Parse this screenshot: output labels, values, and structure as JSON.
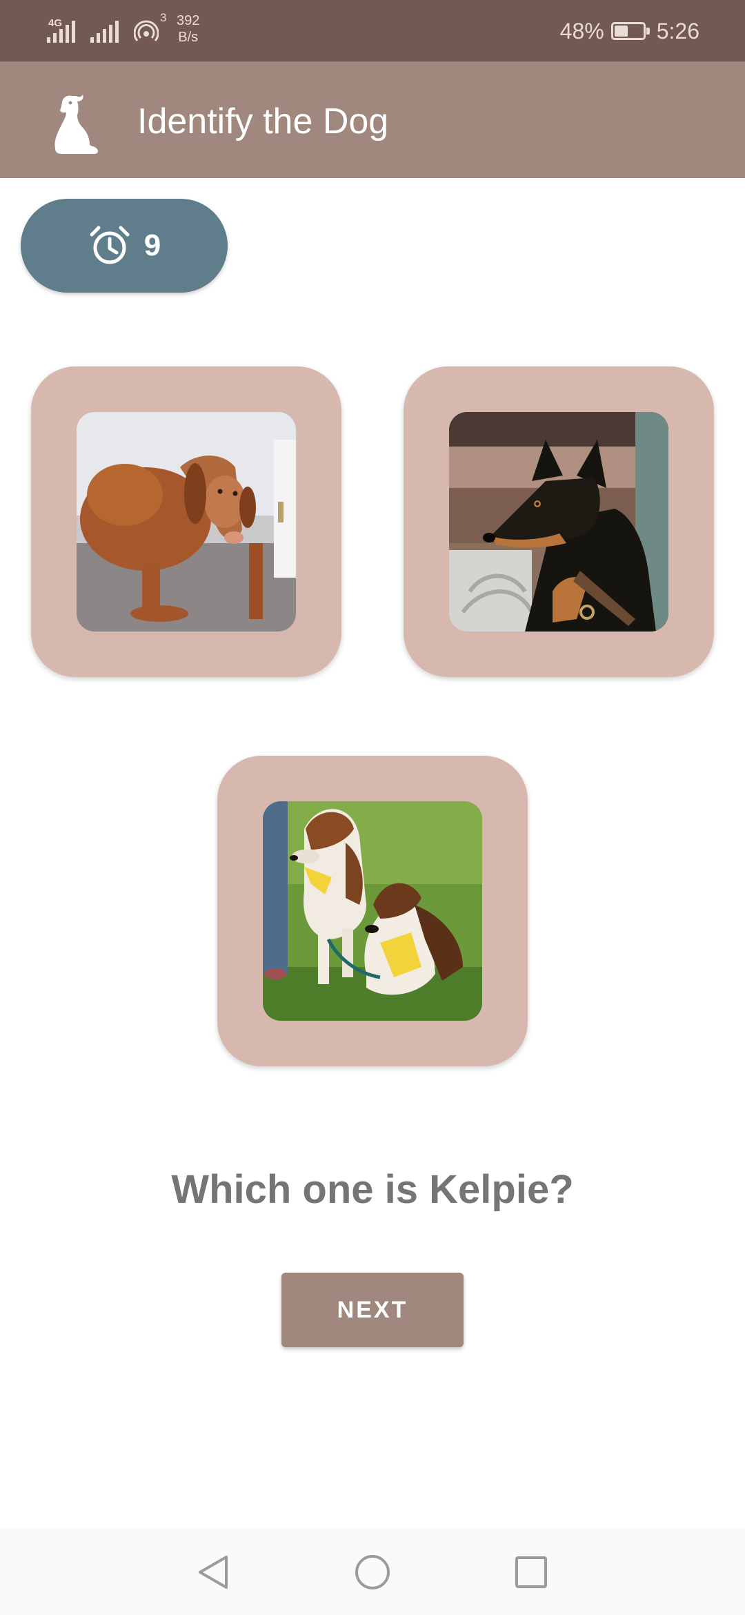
{
  "status_bar": {
    "network": "4G",
    "hotspot_count": "3",
    "speed_value": "392",
    "speed_unit": "B/s",
    "battery_percent": "48%",
    "battery_level": 0.48,
    "time": "5:26",
    "icons": [
      "signal-4g-icon",
      "signal-icon",
      "hotspot-icon",
      "battery-icon"
    ]
  },
  "app_bar": {
    "title": "Identify the Dog",
    "logo_icon": "dog-sitting-icon",
    "background": "#a1887f"
  },
  "timer": {
    "icon": "alarm-clock-icon",
    "value": "9",
    "color": "#607d8b"
  },
  "options": [
    {
      "image_subject": "brown short-haired dog lying on carpet"
    },
    {
      "image_subject": "black and tan kelpie dog with collar"
    },
    {
      "image_subject": "two rough collies with yellow bandanas on grass"
    }
  ],
  "question": "Which one is Kelpie?",
  "next_button": {
    "label": "NEXT"
  },
  "nav_bar": {
    "icons": [
      "back-icon",
      "home-icon",
      "recent-apps-icon"
    ]
  },
  "colors": {
    "status_bar": "#725951",
    "card": "#d7b8ae",
    "question_text": "#757575"
  }
}
